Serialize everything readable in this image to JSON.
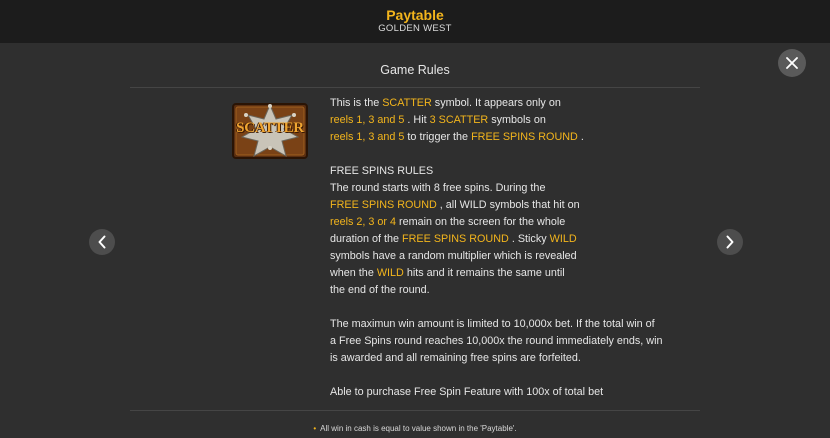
{
  "header": {
    "title": "Paytable",
    "subtitle": "GOLDEN WEST"
  },
  "section_title": "Game Rules",
  "symbol": {
    "label": "SCATTER",
    "icon": "scatter-symbol-icon"
  },
  "scatter_text": {
    "l1": [
      "This is the ",
      "SCATTER",
      " symbol. It appears only on"
    ],
    "l2": [
      "reels 1, 3 and 5",
      " . Hit ",
      "3 SCATTER",
      " symbols on"
    ],
    "l3": [
      "reels 1, 3 and 5",
      " to trigger the ",
      "FREE SPINS ROUND",
      " ."
    ]
  },
  "free_spins": {
    "heading": "FREE SPINS RULES",
    "l1": "The round starts with 8 free spins. During the",
    "l2": [
      "FREE SPINS ROUND",
      " , all WILD symbols that hit on"
    ],
    "l3": [
      "reels 2, 3 or 4",
      " remain on the screen for the whole"
    ],
    "l4": [
      "duration of the ",
      "FREE SPINS ROUND",
      " . Sticky ",
      "WILD"
    ],
    "l5": "symbols have a random multiplier which is revealed",
    "l6": [
      "when the ",
      "WILD",
      " hits and it remains the same until"
    ],
    "l7": "the end of the round."
  },
  "max_win": {
    "l1": "The maximun win amount is limited to 10,000x bet. If the total win of",
    "l2": "a Free Spins round reaches 10,000x the round immediately ends, win",
    "l3": "is awarded and all remaining free spins are forfeited."
  },
  "purchase": "Able to purchase Free Spin Feature with 100x of total bet",
  "footnote": "All win in cash is equal to value shown in the 'Paytable'.",
  "colors": {
    "accent": "#f3b51c",
    "background": "#2f2f2f",
    "header": "#1c1c1c"
  }
}
